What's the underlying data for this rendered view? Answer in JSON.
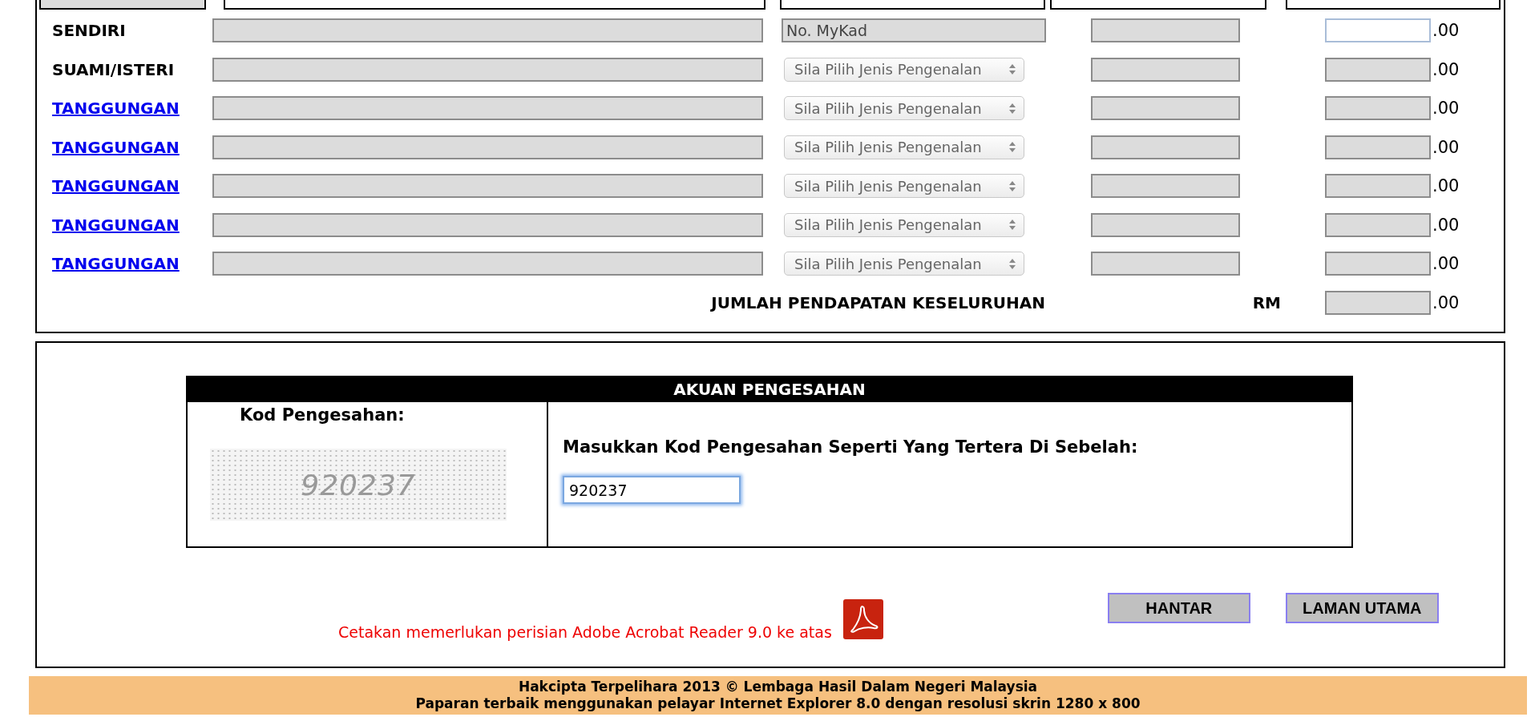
{
  "income_table": {
    "rows": [
      {
        "label": "SENDIRI",
        "is_link": false,
        "name_redacted": false,
        "id_type": {
          "kind": "field",
          "value": "No. MyKad"
        },
        "id_number_redacted": false,
        "amount_editable": true,
        "amount_suffix": ".00"
      },
      {
        "label": "SUAMI/ISTERI",
        "is_link": false,
        "name_redacted": false,
        "id_type": {
          "kind": "select",
          "value": "Sila Pilih Jenis Pengenalan"
        },
        "id_number_redacted": false,
        "amount_editable": false,
        "amount_suffix": ".00"
      },
      {
        "label": "TANGGUNGAN",
        "is_link": true,
        "name_redacted": false,
        "id_type": {
          "kind": "select",
          "value": "Sila Pilih Jenis Pengenalan"
        },
        "id_number_redacted": false,
        "amount_editable": false,
        "amount_suffix": ".00"
      },
      {
        "label": "TANGGUNGAN",
        "is_link": true,
        "name_redacted": false,
        "id_type": {
          "kind": "select",
          "value": "Sila Pilih Jenis Pengenalan"
        },
        "id_number_redacted": false,
        "amount_editable": false,
        "amount_suffix": ".00"
      },
      {
        "label": "TANGGUNGAN",
        "is_link": true,
        "name_redacted": false,
        "id_type": {
          "kind": "select",
          "value": "Sila Pilih Jenis Pengenalan"
        },
        "id_number_redacted": false,
        "amount_editable": false,
        "amount_suffix": ".00"
      },
      {
        "label": "TANGGUNGAN",
        "is_link": true,
        "name_redacted": false,
        "id_type": {
          "kind": "select",
          "value": "Sila Pilih Jenis Pengenalan"
        },
        "id_number_redacted": false,
        "amount_editable": false,
        "amount_suffix": ".00"
      },
      {
        "label": "TANGGUNGAN",
        "is_link": true,
        "name_redacted": false,
        "id_type": {
          "kind": "select",
          "value": "Sila Pilih Jenis Pengenalan"
        },
        "id_number_redacted": false,
        "amount_editable": false,
        "amount_suffix": ".00"
      }
    ],
    "total": {
      "label": "JUMLAH PENDAPATAN KESELURUHAN",
      "currency": "RM",
      "amount_suffix": ".00"
    }
  },
  "verification": {
    "title": "AKUAN PENGESAHAN",
    "code_label": "Kod Pengesahan:",
    "captcha_text": "920237",
    "prompt": "Masukkan Kod Pengesahan Seperti Yang Tertera Di Sebelah:",
    "code_value": "920237",
    "code_focused": true
  },
  "print_note": "Cetakan memerlukan perisian Adobe Acrobat Reader 9.0 ke atas",
  "buttons": [
    "HANTAR",
    "LAMAN UTAMA"
  ],
  "footer": [
    "Hakcipta Terpelihara 2013 © Lembaga Hasil Dalam Negeri Malaysia",
    "Paparan terbaik menggunakan pelayar Internet Explorer 8.0 dengan resolusi skrin 1280 x 800"
  ]
}
